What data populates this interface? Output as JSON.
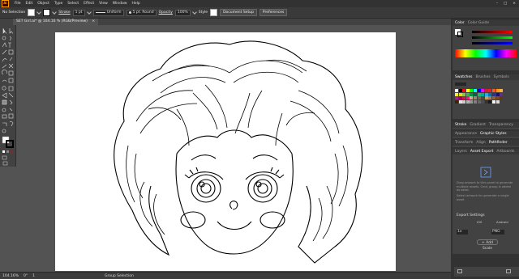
{
  "menubar": {
    "logo": "Ai",
    "items": [
      "File",
      "Edit",
      "Object",
      "Type",
      "Select",
      "Effect",
      "View",
      "Window",
      "Help"
    ]
  },
  "controlbar": {
    "selection": "No Selection",
    "stroke_label": "Stroke",
    "stroke_value": "1 pt",
    "uniform_label": "Uniform",
    "brush_label": "5 pt. Round",
    "opacity_label": "Opacity",
    "opacity_value": "100%",
    "style_label": "Style",
    "doc_setup": "Document Setup",
    "preferences": "Preferences"
  },
  "document": {
    "tab_title": "SET Girl.ai* @ 104.16 % (RGB/Preview)",
    "close": "×"
  },
  "statusbar": {
    "zoom": "104.16%",
    "angle": "0°",
    "artboard": "1",
    "tool": "Group Selection"
  },
  "panels": {
    "color": {
      "tabs": [
        "Color",
        "Color Guide"
      ]
    },
    "swatches": {
      "tabs": [
        "Swatches",
        "Brushes",
        "Symbols"
      ]
    },
    "stroke": {
      "tabs": [
        "Stroke",
        "Gradient",
        "Transparency"
      ]
    },
    "appearance": {
      "tabs": [
        "Appearance",
        "Graphic Styles"
      ]
    },
    "transform": {
      "tabs": [
        "Transform",
        "Align",
        "Pathfinder"
      ]
    },
    "layers": {
      "tabs": [
        "Layers",
        "Asset Export",
        "Artboards"
      ]
    },
    "asset_export": {
      "hint1": "Drag artwork to this panel to generate multiple assets. Cmd, group is added as asset.",
      "hint2": "Select artwork for generate a single asset",
      "export_settings": "Export Settings",
      "ios": "iOS",
      "android": "Android",
      "scale": "1x",
      "format": "PNG",
      "add_scale": "+ Add Scale"
    }
  },
  "colors": {
    "accent": "#ff9a00",
    "swatch_colors": [
      "#ffffff",
      "#000000",
      "#ff0000",
      "#ffff00",
      "#00ff00",
      "#00ffff",
      "#0000ff",
      "#ff00ff",
      "#c1272d",
      "#ed1c24",
      "#f15a24",
      "#f7931e",
      "#fbb03b",
      "#fcee21",
      "#d9e021",
      "#8cc63f",
      "#39b54a",
      "#009245",
      "#006837",
      "#22b573",
      "#00a99d",
      "#29abe2",
      "#0071bc",
      "#2e3192",
      "#1b1464",
      "#662d91",
      "#93278f",
      "#9e005d",
      "#d4145a",
      "#ed1e79",
      "#c7b299",
      "#998675",
      "#736357",
      "#534741",
      "#c69c6d",
      "#a67c52",
      "#8c6239",
      "#754c24",
      "#603813",
      "#42210b",
      "#e6e6e6",
      "#cccccc",
      "#b3b3b3",
      "#999999",
      "#808080",
      "#666666",
      "#4d4d4d",
      "#333333",
      "#1a1a1a",
      "#f2f2f2",
      "#dadada"
    ]
  }
}
